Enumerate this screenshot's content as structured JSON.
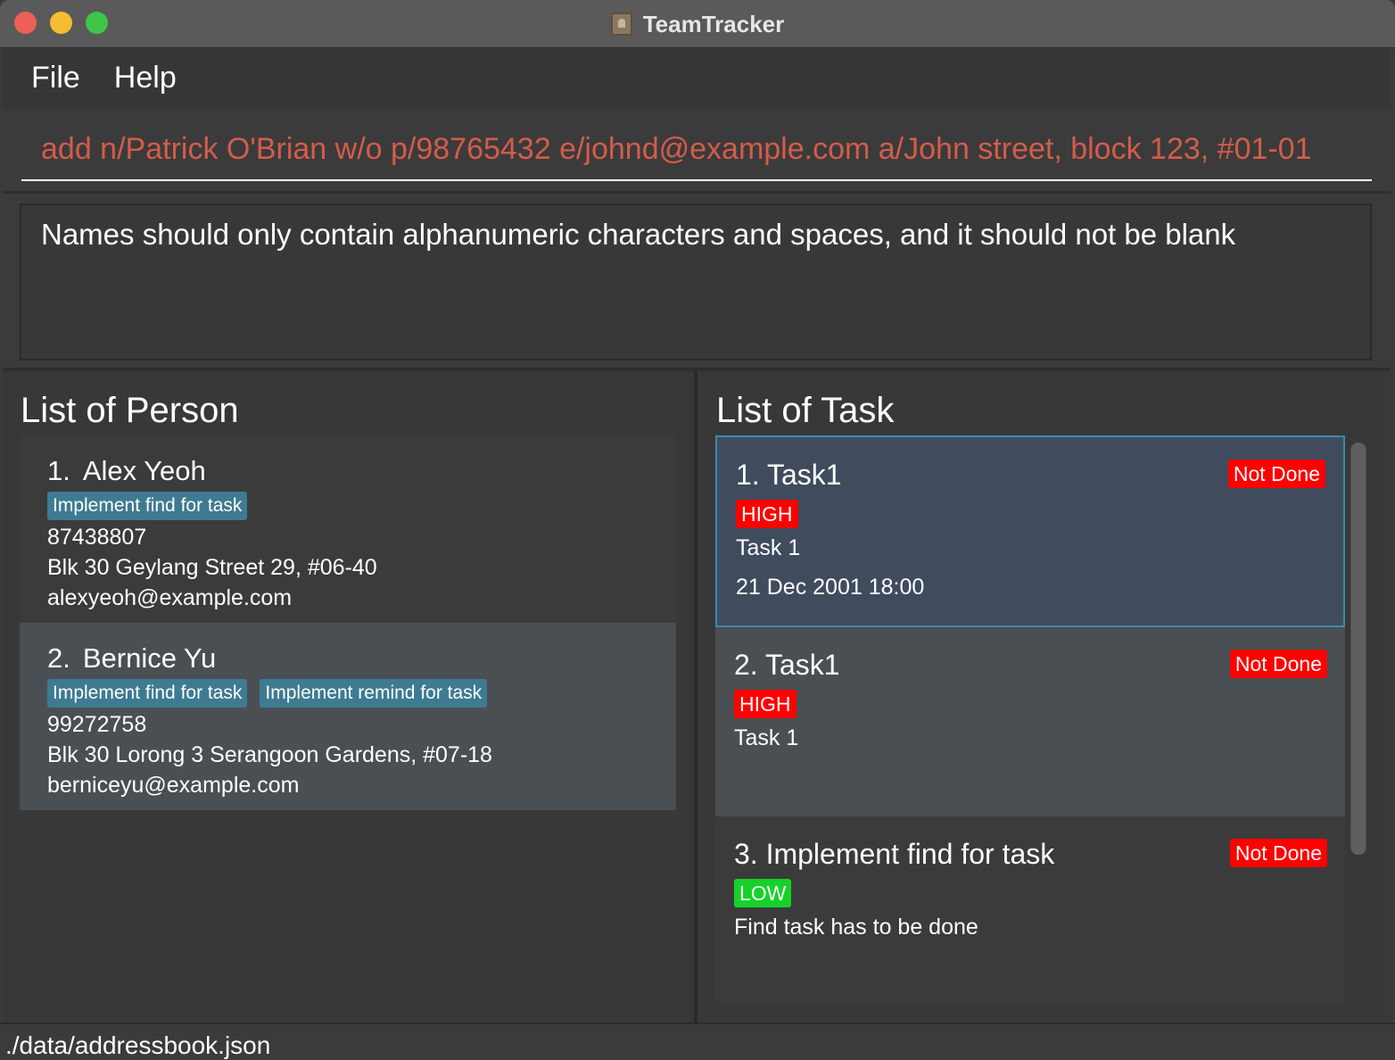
{
  "window": {
    "title": "TeamTracker",
    "icon": "contacts-book-icon"
  },
  "menu": {
    "items": [
      {
        "label": "File"
      },
      {
        "label": "Help"
      }
    ]
  },
  "command": {
    "value": "add n/Patrick O'Brian w/o p/98765432 e/johnd@example.com a/John street, block 123, #01-01"
  },
  "result": {
    "message": "Names should only contain alphanumeric characters and spaces, and it should not be blank"
  },
  "persons": {
    "heading": "List of Person",
    "items": [
      {
        "index": "1.",
        "name": "Alex Yeoh",
        "tags": [
          "Implement find for task"
        ],
        "phone": "87438807",
        "address": "Blk 30 Geylang Street 29, #06-40",
        "email": "alexyeoh@example.com"
      },
      {
        "index": "2.",
        "name": "Bernice Yu",
        "tags": [
          "Implement find for task",
          "Implement remind for task"
        ],
        "phone": "99272758",
        "address": "Blk 30 Lorong 3 Serangoon Gardens, #07-18",
        "email": "berniceyu@example.com"
      }
    ]
  },
  "tasks": {
    "heading": "List of Task",
    "items": [
      {
        "title": "1. Task1",
        "status": "Not Done",
        "priority": "HIGH",
        "description": "Task 1",
        "deadline": "21 Dec 2001 18:00"
      },
      {
        "title": "2. Task1",
        "status": "Not Done",
        "priority": "HIGH",
        "description": "Task 1"
      },
      {
        "title": "3. Implement find for task",
        "status": "Not Done",
        "priority": "LOW",
        "description": "Find task has to be done"
      }
    ]
  },
  "statusbar": {
    "path": "./data/addressbook.json"
  },
  "colors": {
    "tag": "#3e7b91",
    "status_not_done": "#ff0000",
    "priority_high": "#ff0000",
    "priority_low": "#16d12a",
    "command_text": "#d45c4a",
    "selected_task_border": "#3b8ab0"
  }
}
